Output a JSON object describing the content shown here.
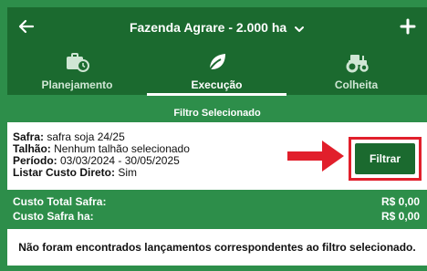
{
  "header": {
    "farm_name": "Fazenda Agrare - 2.000 ha"
  },
  "tabs": [
    {
      "label": "Planejamento",
      "icon": "briefcase-clock-icon"
    },
    {
      "label": "Execução",
      "icon": "leaf-icon",
      "active": true
    },
    {
      "label": "Colheita",
      "icon": "tractor-icon"
    }
  ],
  "filter": {
    "section_title": "Filtro Selecionado",
    "safra_label": "Safra:",
    "safra_value": " safra soja 24/25",
    "talhao_label": "Talhão:",
    "talhao_value": " Nenhum talhão selecionado",
    "periodo_label": "Período:",
    "periodo_value": " 03/03/2024 - 30/05/2025",
    "custo_label": "Listar Custo Direto:",
    "custo_value": " Sim",
    "button_label": "Filtrar"
  },
  "totals": {
    "total_label": "Custo Total Safra:",
    "total_value": "R$ 0,00",
    "ha_label": "Custo Safra ha:",
    "ha_value": "R$ 0,00"
  },
  "empty_message": "Não foram encontrados lançamentos correspondentes ao filtro selecionado.",
  "colors": {
    "primary_dark": "#1b6a2f",
    "primary": "#2d8e4a",
    "highlight_red": "#e11f2b"
  }
}
